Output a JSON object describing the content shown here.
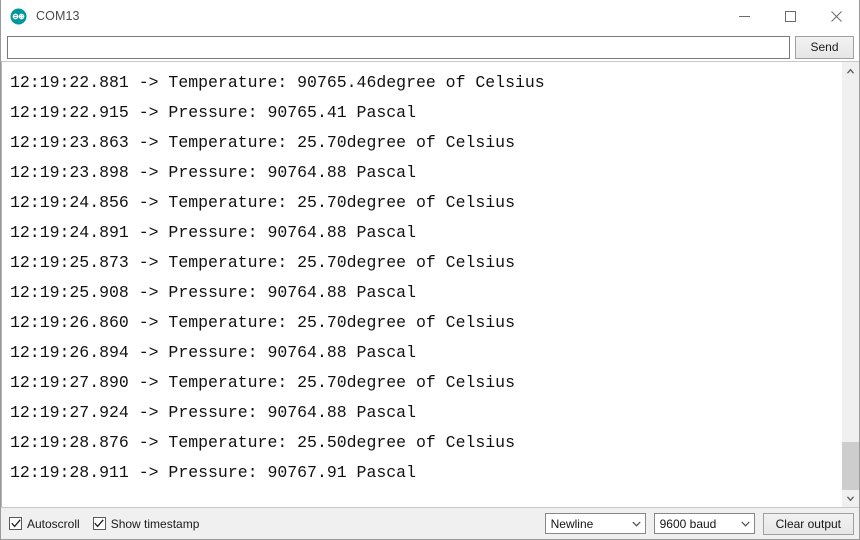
{
  "window": {
    "title": "COM13",
    "logo_icon": "arduino-logo-icon",
    "minimize_label": "—",
    "maximize_label": "☐",
    "close_label": "✕"
  },
  "send_row": {
    "input_value": "",
    "input_placeholder": "",
    "send_label": "Send"
  },
  "console": {
    "lines": [
      "12:19:22.881 -> Temperature: 90765.46degree of Celsius",
      "12:19:22.915 -> Pressure: 90765.41 Pascal",
      "12:19:23.863 -> Temperature: 25.70degree of Celsius",
      "12:19:23.898 -> Pressure: 90764.88 Pascal",
      "12:19:24.856 -> Temperature: 25.70degree of Celsius",
      "12:19:24.891 -> Pressure: 90764.88 Pascal",
      "12:19:25.873 -> Temperature: 25.70degree of Celsius",
      "12:19:25.908 -> Pressure: 90764.88 Pascal",
      "12:19:26.860 -> Temperature: 25.70degree of Celsius",
      "12:19:26.894 -> Pressure: 90764.88 Pascal",
      "12:19:27.890 -> Temperature: 25.70degree of Celsius",
      "12:19:27.924 -> Pressure: 90764.88 Pascal",
      "12:19:28.876 -> Temperature: 25.50degree of Celsius",
      "12:19:28.911 -> Pressure: 90767.91 Pascal"
    ]
  },
  "scrollbar": {
    "up_arrow_icon": "chevron-up-icon",
    "down_arrow_icon": "chevron-down-icon"
  },
  "statusbar": {
    "autoscroll_label": "Autoscroll",
    "autoscroll_checked": true,
    "timestamp_label": "Show timestamp",
    "timestamp_checked": true,
    "ghost_text": "",
    "line_ending_value": "Newline",
    "baud_value": "9600 baud",
    "clear_label": "Clear output"
  },
  "colors": {
    "accent": "#00979c",
    "text": "#111111",
    "chrome": "#f0f0f0"
  }
}
